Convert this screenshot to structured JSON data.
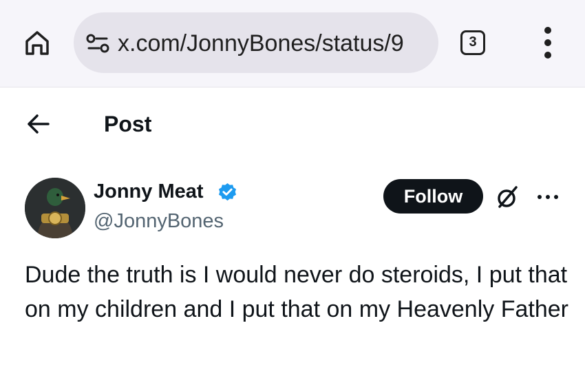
{
  "browser": {
    "url": "x.com/JonnyBones/status/9",
    "tab_count": "3",
    "icons": {
      "home": "home-icon",
      "site_settings": "site-settings-icon",
      "menu": "more-vert-icon"
    }
  },
  "header": {
    "title": "Post",
    "back_icon": "arrow-left-icon"
  },
  "post": {
    "author": {
      "display_name": "Jonny Meat",
      "handle": "@JonnyBones",
      "verified": true,
      "verified_color": "#1d9bf0"
    },
    "follow_label": "Follow",
    "text": "Dude the truth is I would never do steroids, I put that on my children and I put that on my Heavenly Father"
  },
  "colors": {
    "text": "#0f1419",
    "secondary_text": "#536471",
    "follow_bg": "#0f1419",
    "chrome_bg": "#f6f5fa",
    "urlbar_bg": "#e5e3eb"
  }
}
